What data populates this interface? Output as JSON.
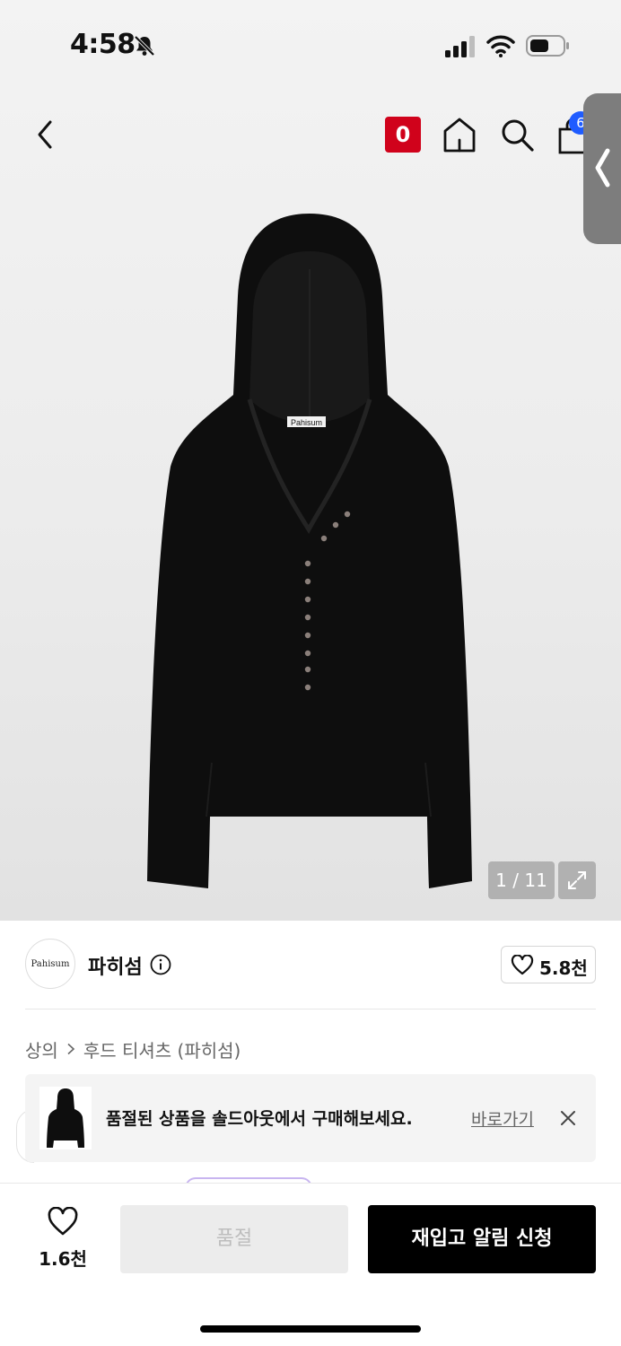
{
  "status": {
    "time": "4:58"
  },
  "nav": {
    "point_badge": "0",
    "cart_count": "6"
  },
  "gallery": {
    "counter": "1 / 11",
    "label_tag": "Pahisum"
  },
  "brand": {
    "logo_text": "Pahisum",
    "name": "파히섬",
    "follow_count": "5.8천"
  },
  "breadcrumb": {
    "level1": "상의",
    "level2": "후드 티셔츠 (파히섬)"
  },
  "banner": {
    "message": "품절된 상품을 솔드아웃에서 구매해보세요.",
    "link": "바로가기"
  },
  "bottom": {
    "like_count": "1.6천",
    "soldout_label": "품절",
    "restock_label": "재입고 알림 신청"
  },
  "colors": {
    "accent_red": "#d0021b",
    "cart_blue": "#1f5cff",
    "primary_black": "#000000"
  }
}
